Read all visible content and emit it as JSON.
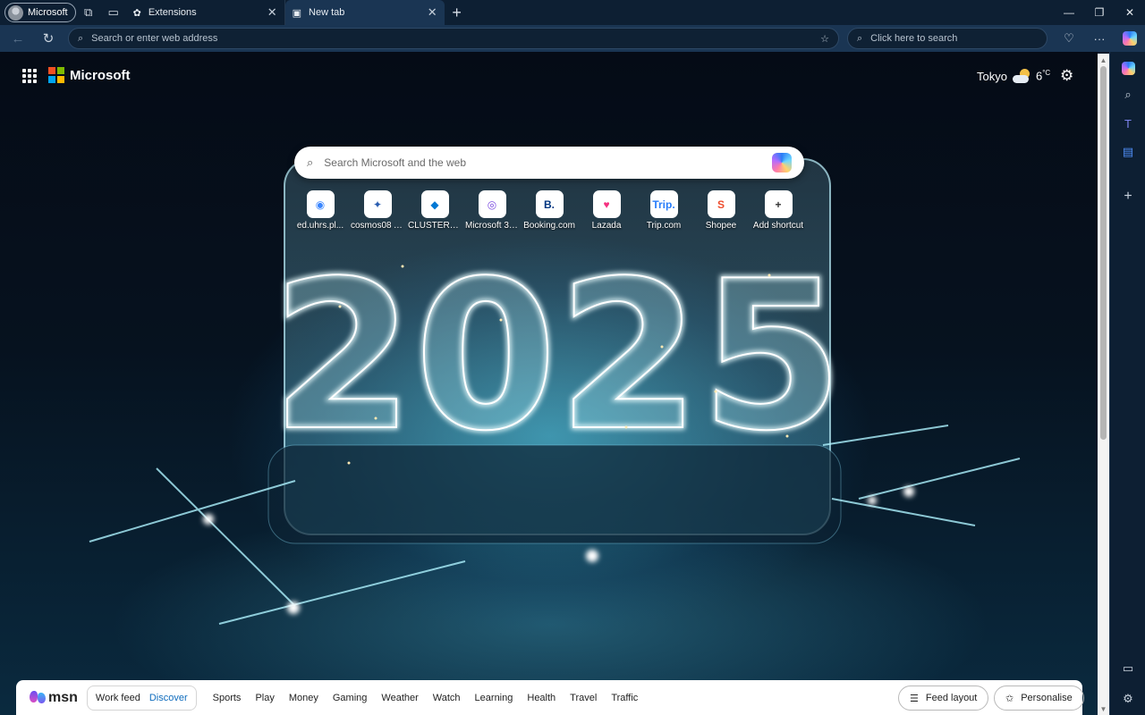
{
  "titlebar": {
    "profile_name": "Microsoft",
    "tabs": [
      {
        "title": "Extensions",
        "active": false
      },
      {
        "title": "New tab",
        "active": true
      }
    ]
  },
  "toolbar": {
    "address_placeholder": "Search or enter web address",
    "search_placeholder": "Click here to search"
  },
  "page": {
    "brand": "Microsoft",
    "weather": {
      "city": "Tokyo",
      "temp": "6",
      "unit": "°C"
    },
    "search_placeholder": "Search Microsoft and the web",
    "background_text": "2025",
    "shortcuts": [
      {
        "label": "ed.uhrs.pl...",
        "glyph": "◉",
        "color": "#3a86ff"
      },
      {
        "label": "cosmos08 A...",
        "glyph": "✦",
        "color": "#2a5db0"
      },
      {
        "label": "CLUSTERED ...",
        "glyph": "◆",
        "color": "#0078d4"
      },
      {
        "label": "Microsoft 365",
        "glyph": "◎",
        "color": "#7b4ce0"
      },
      {
        "label": "Booking.com",
        "glyph": "B.",
        "color": "#003580"
      },
      {
        "label": "Lazada",
        "glyph": "♥",
        "color": "#f5317f"
      },
      {
        "label": "Trip.com",
        "glyph": "Trip.",
        "color": "#287dfa"
      },
      {
        "label": "Shopee",
        "glyph": "S",
        "color": "#ee4d2d"
      },
      {
        "label": "Add shortcut",
        "glyph": "+",
        "color": "#333333"
      }
    ]
  },
  "feed": {
    "brand": "msn",
    "toggle": [
      "Work feed",
      "Discover"
    ],
    "categories": [
      "Sports",
      "Play",
      "Money",
      "Gaming",
      "Weather",
      "Watch",
      "Learning",
      "Health",
      "Travel",
      "Traffic"
    ],
    "layout_label": "Feed layout",
    "personalise_label": "Personalise"
  }
}
